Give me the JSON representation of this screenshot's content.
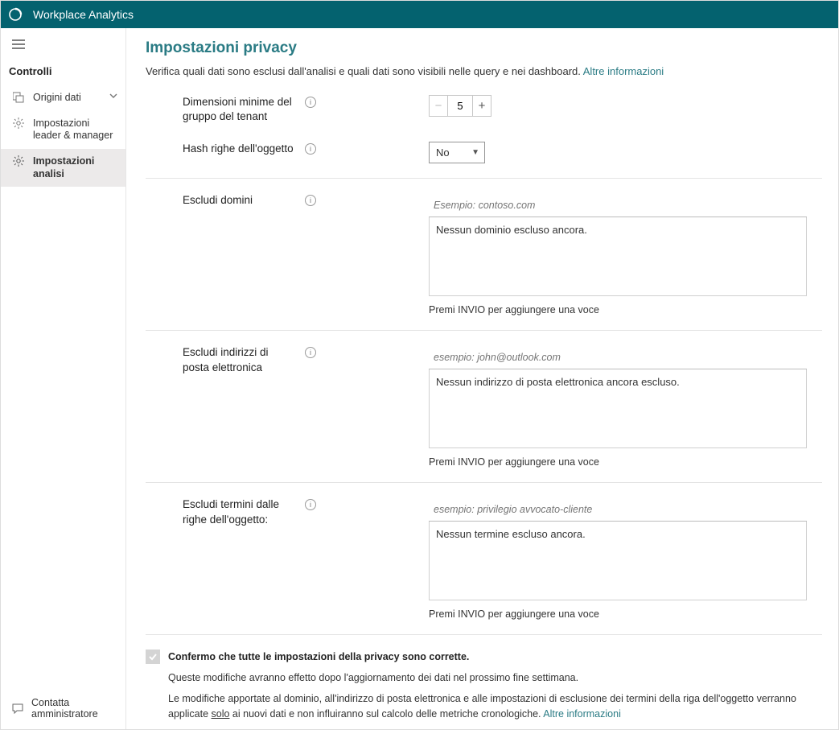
{
  "header": {
    "app_title": "Workplace Analytics"
  },
  "sidebar": {
    "section_title": "Controlli",
    "items": [
      {
        "label": "Origini dati"
      },
      {
        "label": "Impostazioni leader & manager"
      },
      {
        "label": "Impostazioni analisi"
      }
    ],
    "contact_admin": "Contatta amministratore"
  },
  "page": {
    "title": "Impostazioni privacy",
    "description": "Verifica quali dati sono esclusi dall'analisi e quali dati sono visibili nelle query e nei dashboard. ",
    "more_info": "Altre informazioni"
  },
  "settings": {
    "group_size": {
      "label": "Dimensioni minime del gruppo del tenant",
      "value": "5"
    },
    "hash_subject": {
      "label": "Hash righe dell'oggetto",
      "value": "No"
    },
    "exclude_domains": {
      "label": "Escludi domini",
      "placeholder": "Esempio: contoso.com",
      "empty": "Nessun dominio escluso ancora.",
      "hint": "Premi INVIO per aggiungere una voce"
    },
    "exclude_emails": {
      "label": "Escludi indirizzi di posta elettronica",
      "placeholder": "esempio: john@outlook.com",
      "empty": "Nessun indirizzo di posta elettronica ancora escluso.",
      "hint": "Premi INVIO per aggiungere una voce"
    },
    "exclude_terms": {
      "label": "Escludi termini dalle righe dell'oggetto:",
      "placeholder": "esempio: privilegio avvocato-cliente",
      "empty": "Nessun termine escluso ancora.",
      "hint": "Premi INVIO per aggiungere una voce"
    }
  },
  "confirm": {
    "label": "Confermo che tutte le impostazioni della privacy sono corrette.",
    "sub": "Queste modifiche avranno effetto dopo l'aggiornamento dei dati nel prossimo fine settimana.",
    "para_1": "Le modifiche apportate al dominio, all'indirizzo di posta elettronica e alle impostazioni di esclusione dei termini della riga dell'oggetto verranno applicate ",
    "only": "solo",
    "para_2": " ai nuovi dati e non influiranno sul calcolo delle metriche cronologiche. ",
    "more_info": "Altre informazioni"
  }
}
